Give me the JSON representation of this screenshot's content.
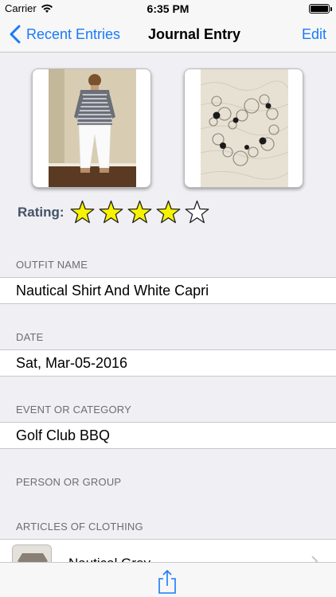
{
  "status_bar": {
    "carrier": "Carrier",
    "time": "6:35 PM"
  },
  "nav": {
    "back_label": "Recent Entries",
    "title": "Journal Entry",
    "edit_label": "Edit"
  },
  "rating": {
    "label": "Rating:",
    "value": 4,
    "max": 5
  },
  "sections": {
    "outfit_name": {
      "header": "OUTFIT NAME",
      "value": "Nautical Shirt And White Capri"
    },
    "date": {
      "header": "DATE",
      "value": "Sat, Mar-05-2016"
    },
    "event": {
      "header": "EVENT OR CATEGORY",
      "value": "Golf Club BBQ"
    },
    "person": {
      "header": "PERSON OR GROUP"
    },
    "articles": {
      "header": "ARTICLES OF CLOTHING",
      "items": [
        {
          "name": "Nautical Grey"
        }
      ]
    }
  },
  "colors": {
    "accent": "#1a7af8",
    "star_fill": "#f7f300",
    "background": "#efeff4"
  },
  "icons": {
    "back": "chevron-left-icon",
    "share": "share-icon",
    "star": "star-icon",
    "disclosure": "chevron-right-icon"
  }
}
